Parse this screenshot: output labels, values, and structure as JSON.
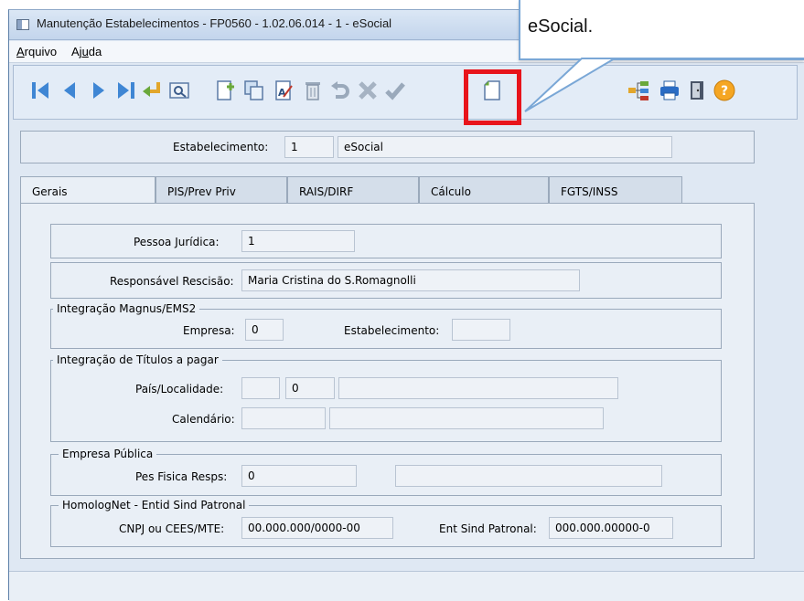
{
  "window": {
    "title": "Manutenção Estabelecimentos - FP0560 - 1.02.06.014 - 1 - eSocial"
  },
  "menu": {
    "items": [
      {
        "label": "Arquivo",
        "mnemonic_index": 0
      },
      {
        "label": "Ajuda",
        "mnemonic_index": 2
      }
    ]
  },
  "toolbar": {
    "buttons": [
      "first-icon",
      "previous-icon",
      "next-icon",
      "last-icon",
      "goto-icon",
      "search-icon",
      "new-icon",
      "copy-icon",
      "edit-icon",
      "delete-icon",
      "undo-icon",
      "cancel-icon",
      "save-icon",
      "complement-icon",
      "tree-icon",
      "print-icon",
      "exit-icon",
      "help-icon"
    ]
  },
  "header": {
    "estabelecimento_label": "Estabelecimento:",
    "estabelecimento_code": "1",
    "estabelecimento_name": "eSocial"
  },
  "tabs": [
    {
      "label": "Gerais",
      "active": true
    },
    {
      "label": "PIS/Prev Priv",
      "active": false
    },
    {
      "label": "RAIS/DIRF",
      "active": false
    },
    {
      "label": "Cálculo",
      "active": false
    },
    {
      "label": "FGTS/INSS",
      "active": false
    }
  ],
  "gerais": {
    "pessoa_juridica_label": "Pessoa Jurídica:",
    "pessoa_juridica_value": "1",
    "responsavel_label": "Responsável Rescisão:",
    "responsavel_value": "Maria Cristina do S.Romagnolli",
    "magnus": {
      "legend": "Integração Magnus/EMS2",
      "empresa_label": "Empresa:",
      "empresa_value": "0",
      "estab_label": "Estabelecimento:",
      "estab_value": ""
    },
    "titulos": {
      "legend": "Integração de Títulos a pagar",
      "pais_label": "País/Localidade:",
      "pais_value": "",
      "localidade_value": "0",
      "localidade_desc": "",
      "calendario_label": "Calendário:",
      "calendario_value": "",
      "calendario_desc": ""
    },
    "empresa_publica": {
      "legend": "Empresa Pública",
      "pes_fisica_label": "Pes Fisica Resps:",
      "pes_fisica_value": "0",
      "pes_fisica_desc": ""
    },
    "homolognet": {
      "legend": "HomologNet - Entid Sind Patronal",
      "cnpj_label": "CNPJ ou CEES/MTE:",
      "cnpj_value": "00.000.000/0000-00",
      "ent_sind_label": "Ent Sind Patronal:",
      "ent_sind_value": "000.000.00000-0"
    }
  },
  "callout": {
    "text": "eSocial."
  },
  "colors": {
    "highlight": "#e8141b",
    "callout_border": "#7aa7d6",
    "window_bg": "#dfe8f3"
  }
}
